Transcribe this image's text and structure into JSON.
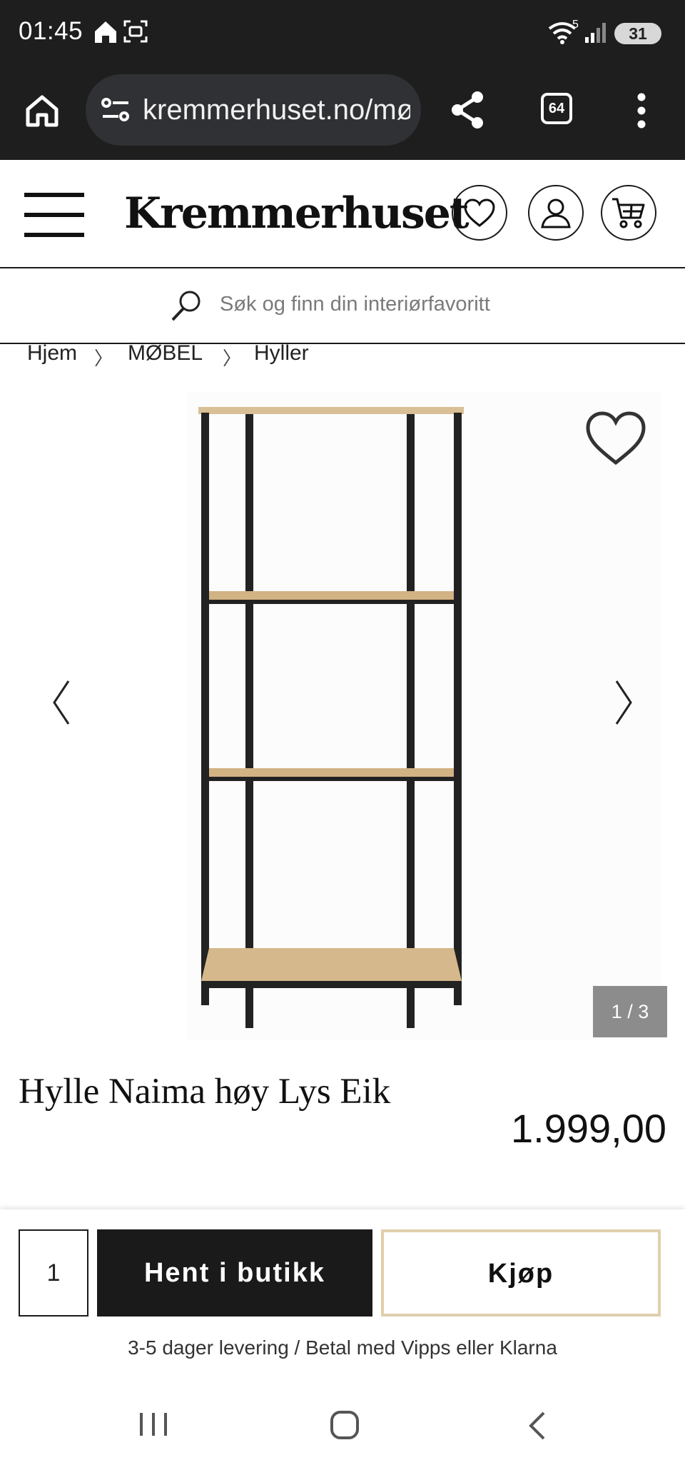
{
  "status_bar": {
    "time": "01:45",
    "wifi_label": "5",
    "battery": "31"
  },
  "browser": {
    "url": "kremmerhuset.no/møbel",
    "tab_count": "64"
  },
  "header": {
    "logo": "Kremmerhuset",
    "search_placeholder": "Søk og finn din interiørfavoritt"
  },
  "breadcrumb": {
    "items": [
      "Hjem",
      "MØBEL",
      "Hyller"
    ],
    "separator": "〉"
  },
  "gallery": {
    "counter": "1 / 3",
    "current_image": 1,
    "total_images": 3
  },
  "product": {
    "title": "Hylle Naima høy Lys Eik",
    "price": "1.999,00"
  },
  "buy_bar": {
    "quantity": "1",
    "pickup_label": "Hent i butikk",
    "buy_label": "Kjøp",
    "delivery_note": "3-5 dager levering / Betal med Vipps eller Klarna"
  },
  "colors": {
    "chrome_bg": "#1e1e1e",
    "url_pill_bg": "#303134",
    "primary_dark": "#1a1a1a",
    "buy_border": "#e0cfae",
    "counter_bg": "#8c8c8c"
  }
}
